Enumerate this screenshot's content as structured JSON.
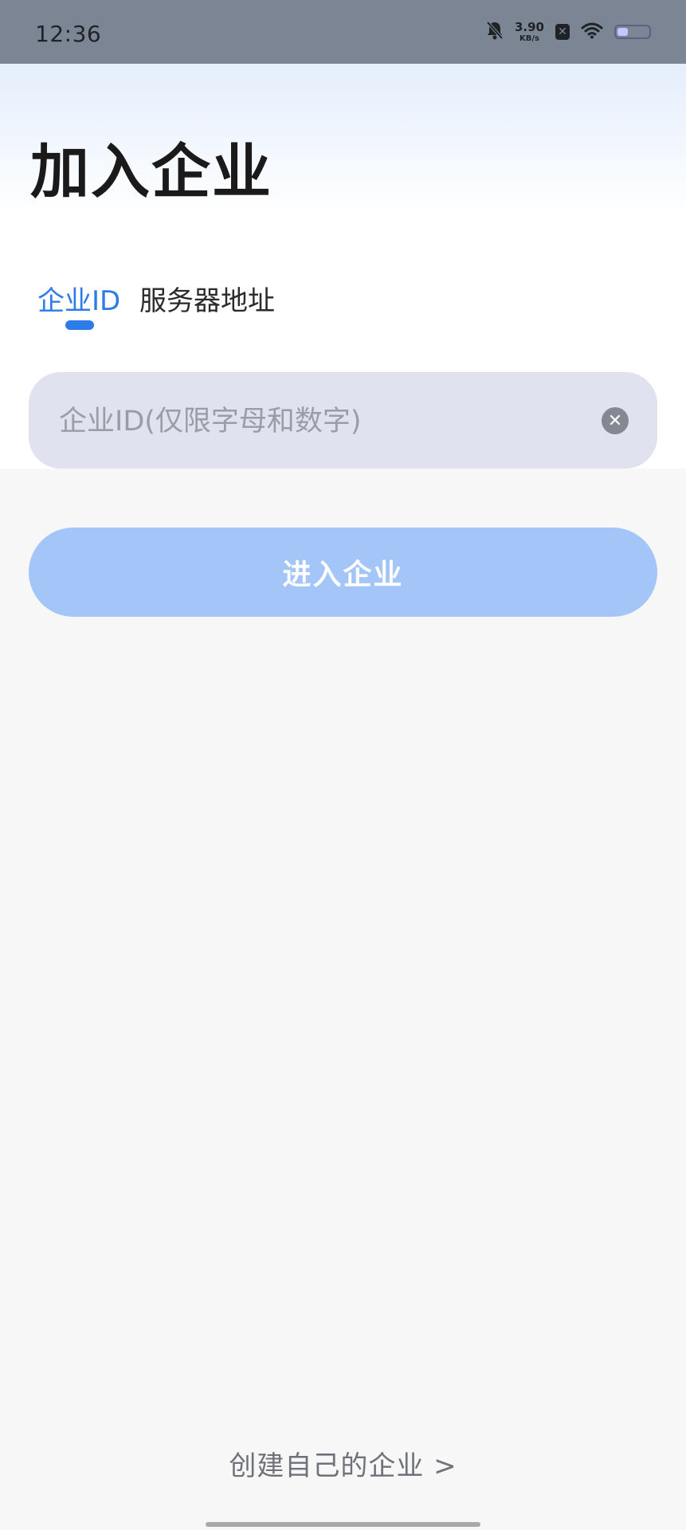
{
  "status_bar": {
    "time": "12:36",
    "net_speed_value": "3.90",
    "net_speed_unit": "KB/s",
    "x_badge": "✕",
    "battery_level": 0.35,
    "icons": [
      "bell-muted-icon",
      "x-badge-icon",
      "wifi-icon",
      "battery-icon"
    ]
  },
  "page": {
    "title": "加入企业"
  },
  "tabs": [
    {
      "label": "企业ID",
      "active": true
    },
    {
      "label": "服务器地址",
      "active": false
    }
  ],
  "input": {
    "value": "",
    "placeholder": "企业ID(仅限字母和数字)",
    "clear_icon": "✕"
  },
  "enter_button": {
    "label": "进入企业"
  },
  "create_link": {
    "label": "创建自己的企业 >"
  },
  "colors": {
    "accent": "#2d7be8",
    "button_disabled": "#a3c5f8",
    "input_bg": "#e0e2ef",
    "page_bg": "#f7f7f8",
    "status_bar_bg": "#7c8593"
  }
}
